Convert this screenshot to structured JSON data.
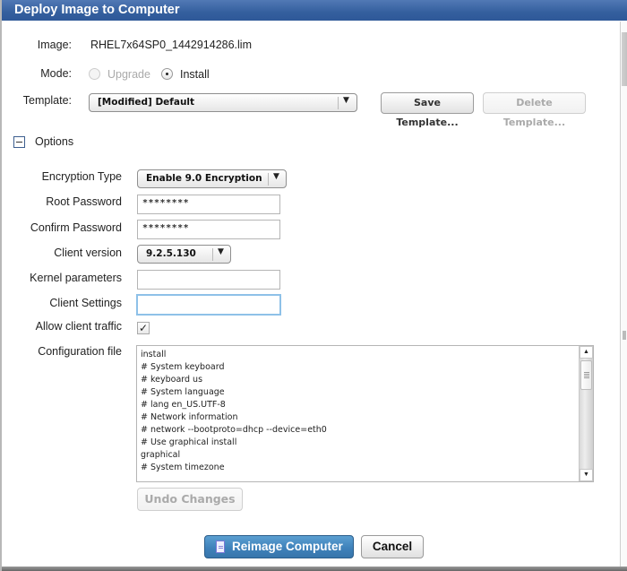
{
  "dialog": {
    "title": "Deploy Image to Computer"
  },
  "image": {
    "label": "Image:",
    "value": "RHEL7x64SP0_1442914286.lim"
  },
  "mode": {
    "label": "Mode:",
    "options": [
      {
        "label": "Upgrade",
        "selected": false,
        "disabled": true
      },
      {
        "label": "Install",
        "selected": true,
        "disabled": false
      }
    ]
  },
  "template": {
    "label": "Template:",
    "selected": "[Modified] Default",
    "save_label": "Save Template...",
    "delete_label": "Delete Template..."
  },
  "options": {
    "section_label": "Options",
    "expanded": true,
    "encryption_type": {
      "label": "Encryption Type",
      "selected": "Enable 9.0 Encryption"
    },
    "root_password": {
      "label": "Root Password",
      "value": "********"
    },
    "confirm_password": {
      "label": "Confirm Password",
      "value": "********"
    },
    "client_version": {
      "label": "Client version",
      "selected": "9.2.5.130"
    },
    "kernel_parameters": {
      "label": "Kernel parameters",
      "value": ""
    },
    "client_settings": {
      "label": "Client Settings",
      "value": ""
    },
    "allow_client_traffic": {
      "label": "Allow client traffic",
      "checked": true,
      "check_glyph": "✓"
    },
    "configuration_file": {
      "label": "Configuration file",
      "lines": [
        "install",
        "# System keyboard",
        "# keyboard us",
        "# System language",
        "# lang en_US.UTF-8",
        "# Network information",
        "# network --bootproto=dhcp --device=eth0",
        "# Use graphical install",
        "graphical",
        "# System timezone"
      ]
    },
    "undo_label": "Undo Changes"
  },
  "footer": {
    "primary_label": "Reimage Computer",
    "cancel_label": "Cancel"
  },
  "icons": {
    "caret": "▼",
    "scroll_up": "▲",
    "scroll_down": "▼"
  }
}
